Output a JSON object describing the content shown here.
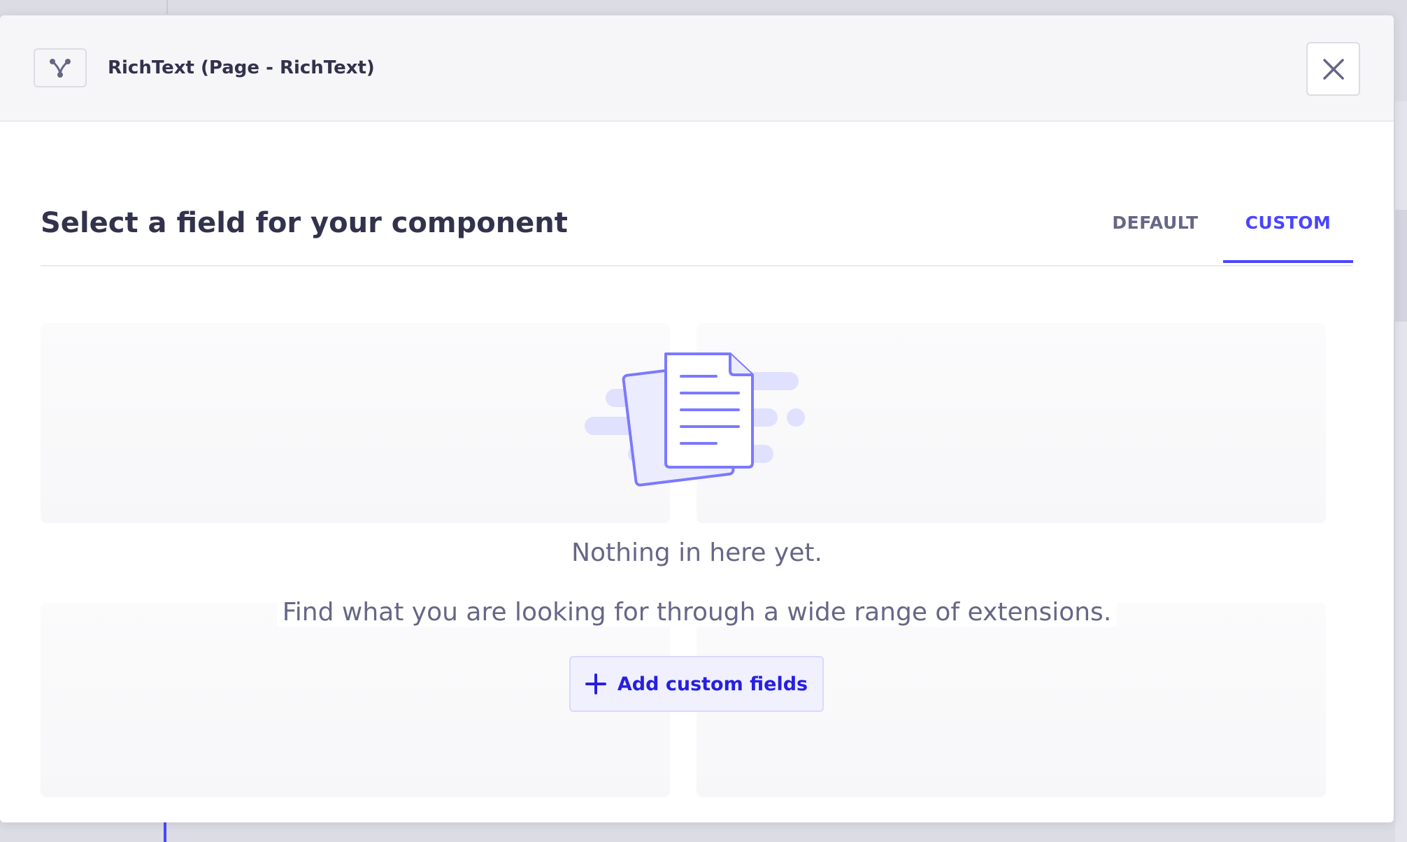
{
  "modal": {
    "component_title": "RichText (Page - RichText)",
    "heading": "Select a field for your component",
    "tabs": [
      {
        "label": "DEFAULT",
        "active": false
      },
      {
        "label": "CUSTOM",
        "active": true
      }
    ],
    "empty_state": {
      "title": "Nothing in here yet.",
      "description": "Find what you are looking for through a wide range of extensions.",
      "action_label": "Add custom fields"
    }
  },
  "icons": {
    "component": "relation-icon",
    "close": "close-icon",
    "add": "plus-icon",
    "illustration": "documents-illustration"
  },
  "colors": {
    "accent": "#4945ff",
    "accent_dark": "#271fe0",
    "text_primary": "#32324d",
    "text_secondary": "#666687",
    "header_bg": "#f6f6f9",
    "button_bg": "#f0f0ff"
  }
}
